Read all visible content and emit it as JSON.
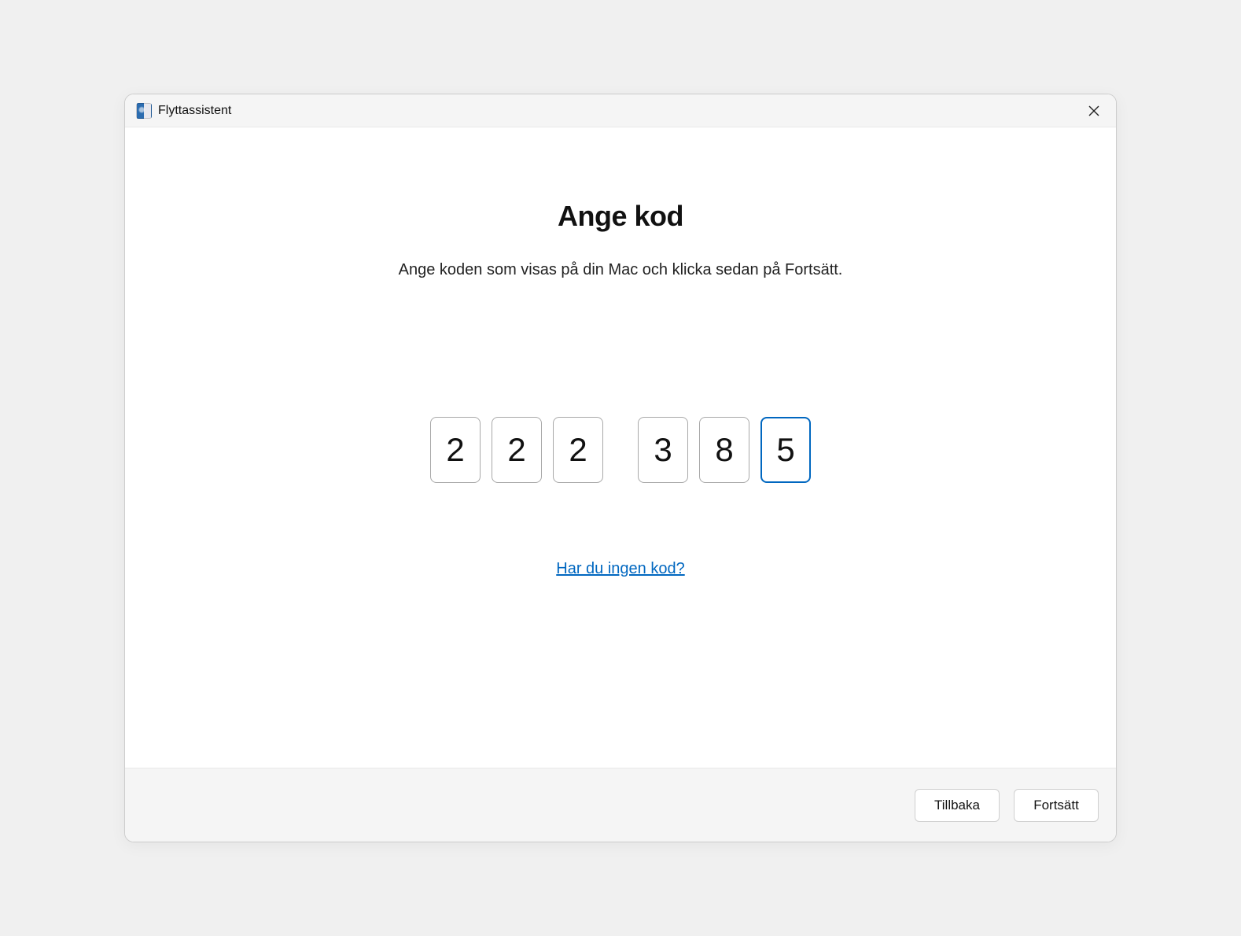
{
  "titlebar": {
    "title": "Flyttassistent"
  },
  "main": {
    "heading": "Ange kod",
    "subtext": "Ange koden som visas på din Mac och klicka sedan på Fortsätt.",
    "code_digits": [
      "2",
      "2",
      "2",
      "3",
      "8",
      "5"
    ],
    "active_index": 5,
    "help_link": "Har du ingen kod?"
  },
  "footer": {
    "back_label": "Tillbaka",
    "continue_label": "Fortsätt"
  }
}
